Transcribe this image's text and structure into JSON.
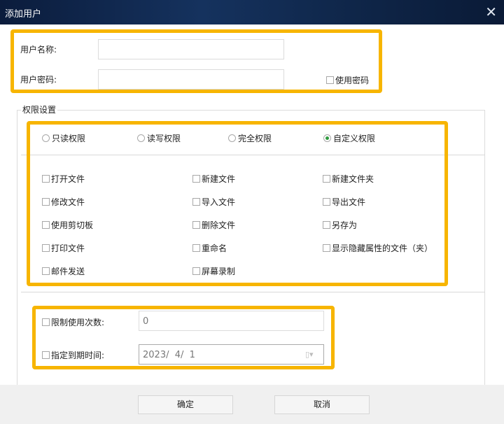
{
  "window": {
    "title": "添加用户",
    "close_icon": "close-icon"
  },
  "account": {
    "name_label": "用户名称:",
    "name_value": "",
    "password_label": "用户密码:",
    "password_value": "",
    "use_password_label": "使用密码",
    "use_password_checked": false
  },
  "permissions": {
    "group_label": "权限设置",
    "modes": [
      {
        "label": "只读权限",
        "selected": false
      },
      {
        "label": "读写权限",
        "selected": false
      },
      {
        "label": "完全权限",
        "selected": false
      },
      {
        "label": "自定义权限",
        "selected": true
      }
    ],
    "items": [
      {
        "label": "打开文件"
      },
      {
        "label": "新建文件"
      },
      {
        "label": "新建文件夹"
      },
      {
        "label": "修改文件"
      },
      {
        "label": "导入文件"
      },
      {
        "label": "导出文件"
      },
      {
        "label": "使用剪切板"
      },
      {
        "label": "删除文件"
      },
      {
        "label": "另存为"
      },
      {
        "label": "打印文件"
      },
      {
        "label": "重命名"
      },
      {
        "label": "显示隐藏属性的文件（夹）"
      },
      {
        "label": "邮件发送"
      },
      {
        "label": "屏幕录制"
      }
    ]
  },
  "limits": {
    "count_label": "限制使用次数:",
    "count_value": "0",
    "expiry_label": "指定到期时间:",
    "expiry_value": "2023/  4/  1"
  },
  "footer": {
    "ok_label": "确定",
    "cancel_label": "取消"
  },
  "colors": {
    "highlight": "#f7b500",
    "titlebar": "#0f2649",
    "radio_selected": "#2f9a3f"
  }
}
